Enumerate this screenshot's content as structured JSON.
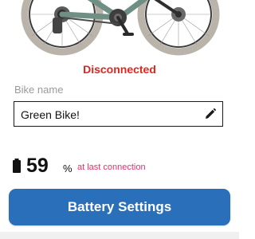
{
  "colors": {
    "status": "#e3241e",
    "accent": "#2a6fb9",
    "note": "#e9306a",
    "bike_frame": "#6f8f84"
  },
  "bike_image": {
    "icon": "e-bike-image"
  },
  "status": {
    "text": "Disconnected"
  },
  "bike_name": {
    "label": "Bike name",
    "value": "Green Bike!",
    "edit_icon": "pencil-icon"
  },
  "battery": {
    "icon": "battery-icon",
    "level": "59",
    "unit": "%",
    "note": "at last connection"
  },
  "actions": {
    "battery_settings_label": "Battery Settings"
  }
}
